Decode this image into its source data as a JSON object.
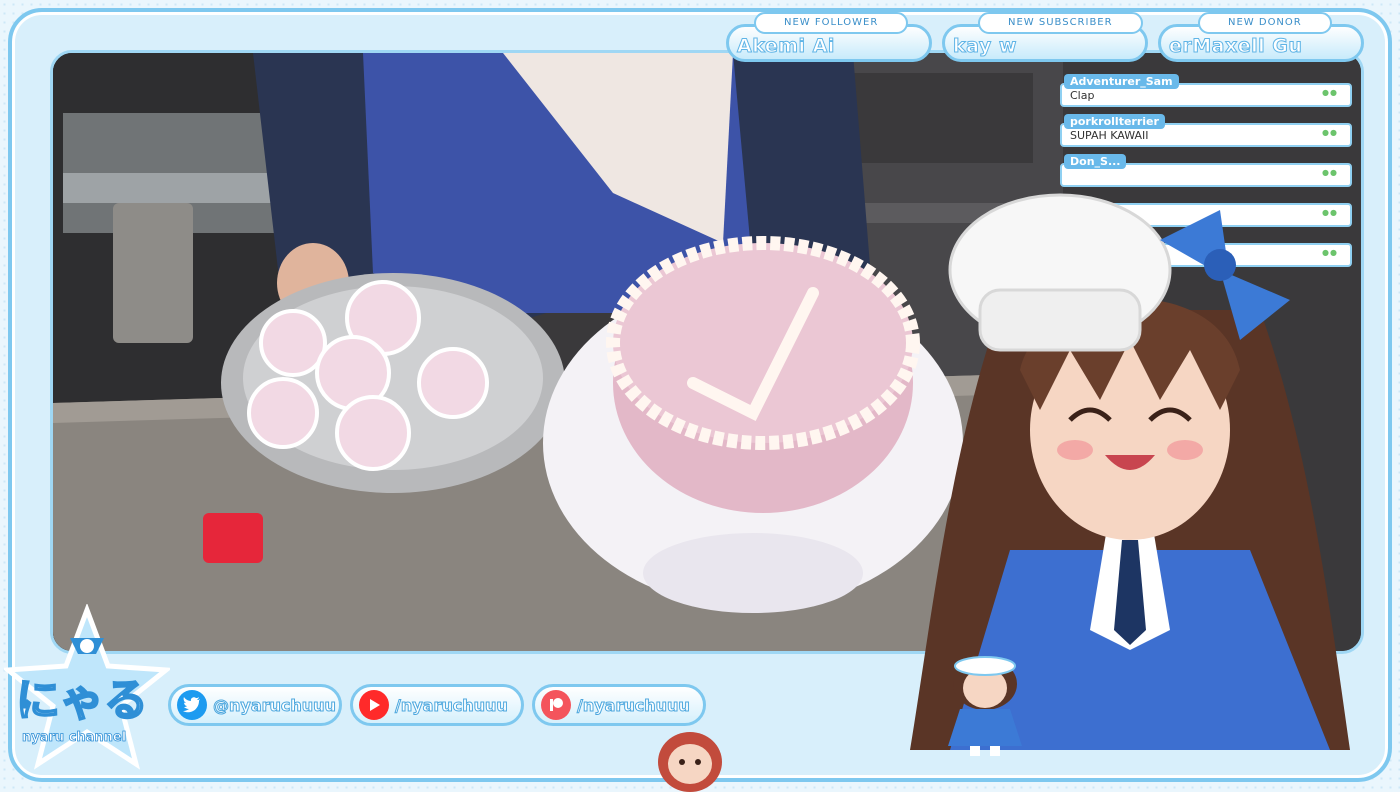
{
  "alerts": [
    {
      "tag": "NEW FOLLOWER",
      "name": "Akemi Ai"
    },
    {
      "tag": "NEW SUBSCRIBER",
      "name": "kay                 w"
    },
    {
      "tag": "NEW DONOR",
      "name": "erMaxell            Gu"
    }
  ],
  "chat": [
    {
      "user": "Adventurer_Sam",
      "message": "Clap"
    },
    {
      "user": "porkrollterrier",
      "message": "SUPAH KAWAII"
    },
    {
      "user": "Don_S...",
      "message": ""
    },
    {
      "user": "",
      "message": ""
    },
    {
      "user": "",
      "message": ""
    }
  ],
  "socials": [
    {
      "icon": "twitter-icon",
      "handle": "@nyaruchuuu",
      "color": "#1d9bf0"
    },
    {
      "icon": "youtube-icon",
      "handle": "/nyaruchuuu",
      "color": "#ff2a2a"
    },
    {
      "icon": "patreon-icon",
      "handle": "/nyaruchuuu",
      "color": "#f4545c"
    }
  ],
  "logo": {
    "name": "にゃる",
    "sub": "nyaru channel"
  },
  "colors": {
    "accent": "#7ec8ef",
    "handle_stroke": "#4ca7de"
  }
}
